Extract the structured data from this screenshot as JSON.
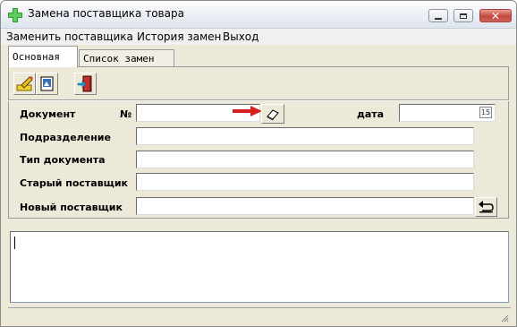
{
  "window": {
    "title": "Замена поставщика товара"
  },
  "menu": {
    "items": [
      "Заменить поставщика",
      "История замен",
      "Выход"
    ]
  },
  "tabs": [
    "Основная",
    "Список замен"
  ],
  "form": {
    "document_label": "Документ",
    "number_label": "№",
    "number_value": "",
    "date_label": "дата",
    "date_value": "",
    "calendar_badge": "15",
    "department_label": "Подразделение",
    "department_value": "",
    "doctype_label": "Тип документа",
    "doctype_value": "",
    "old_supplier_label": "Старый поставщик",
    "old_supplier_value": "",
    "new_supplier_label": "Новый поставщик",
    "new_supplier_value": ""
  },
  "memo": {
    "value": ""
  },
  "colors": {
    "arrow": "#d62020",
    "close_button": "#c4483a"
  }
}
